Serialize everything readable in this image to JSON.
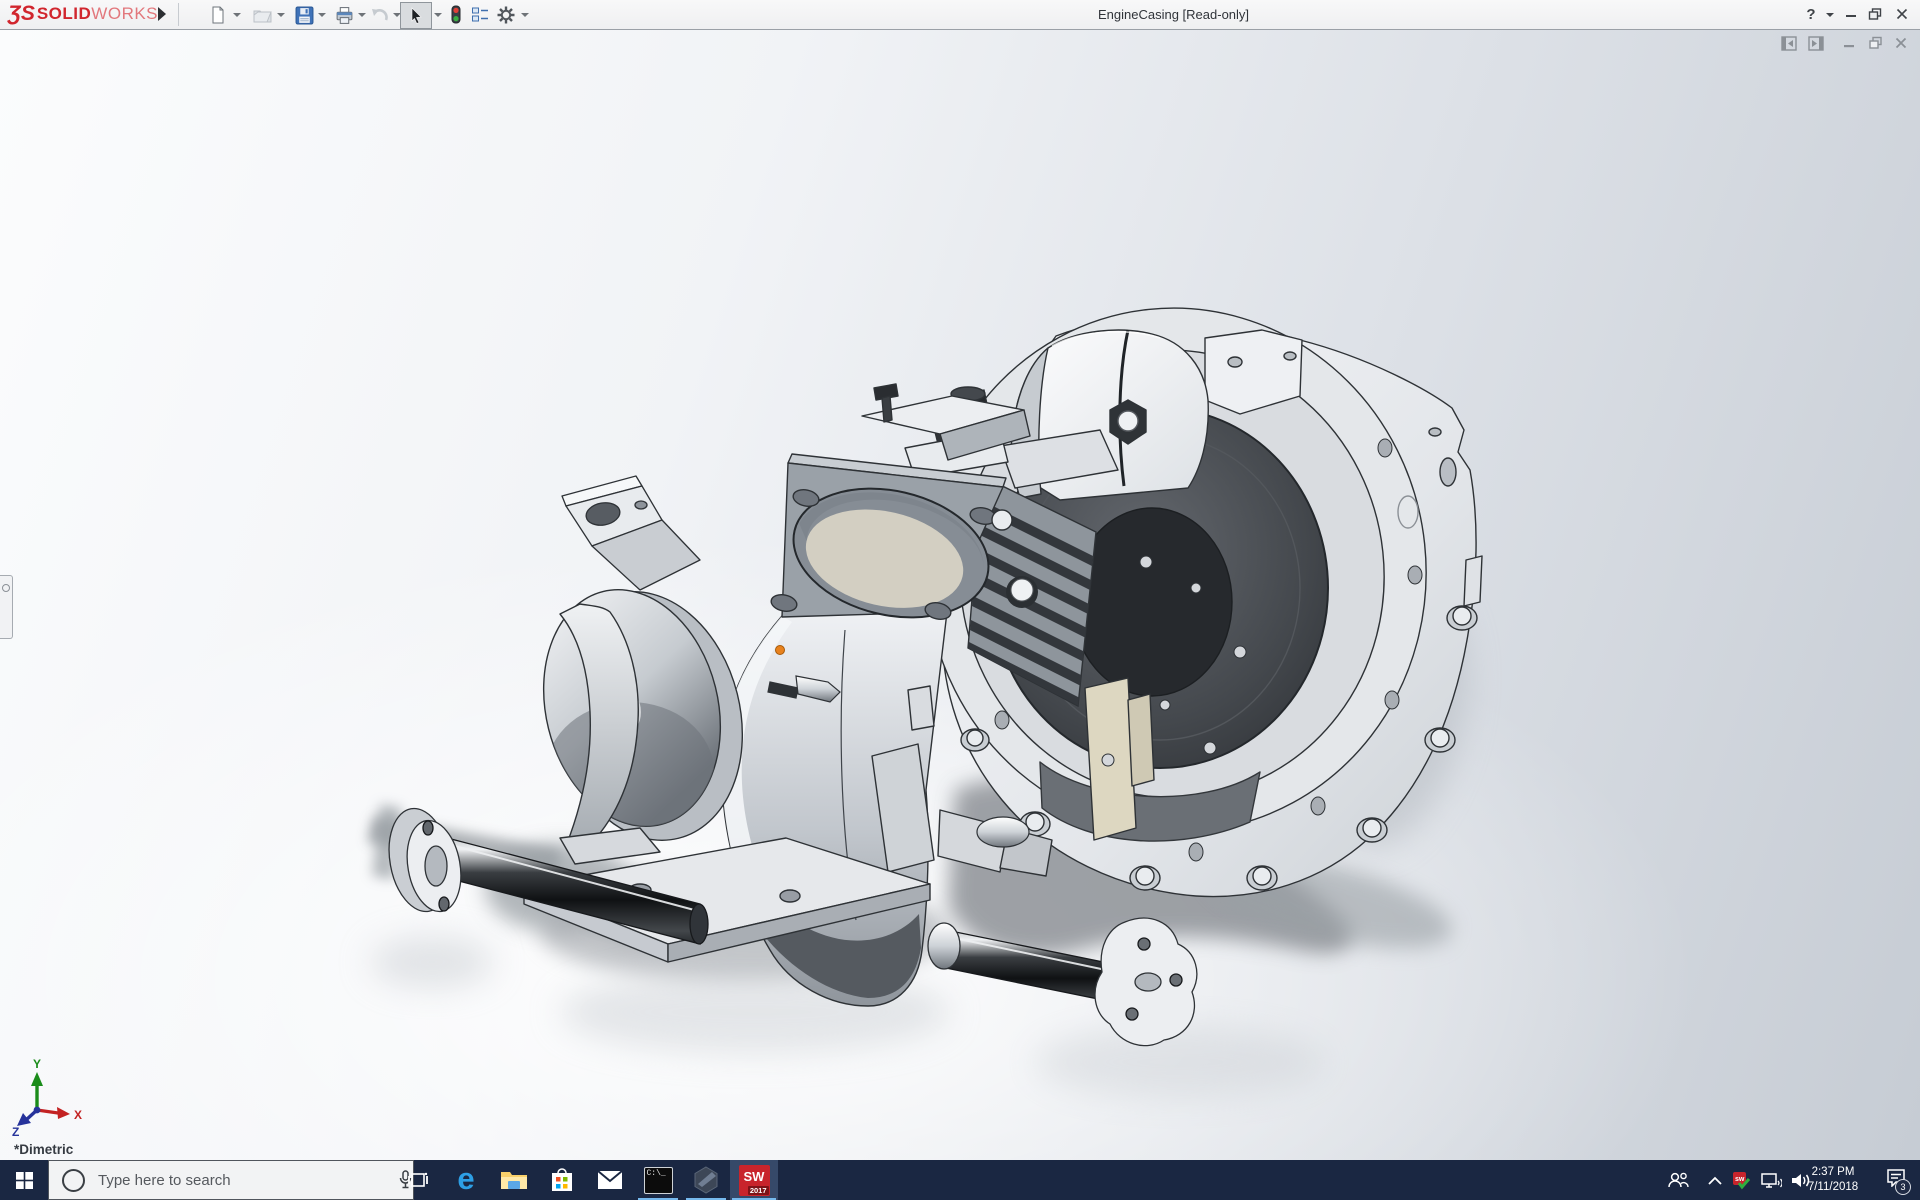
{
  "window": {
    "title": "EngineCasing [Read-only]"
  },
  "brand": {
    "glyph": "ƷS",
    "name_bold": "SOLID",
    "name_light": "WORKS"
  },
  "titlebar": {
    "help_label": "?",
    "icons": [
      "new-document",
      "open",
      "save",
      "print",
      "undo",
      "select-cursor",
      "rebuild-traffic-light",
      "display-pane",
      "settings-gear"
    ],
    "window_controls": [
      "help",
      "minimize",
      "restore",
      "close"
    ]
  },
  "document_window": {
    "controls": [
      "pane-left",
      "pane-right",
      "minimize",
      "restore",
      "close"
    ]
  },
  "viewport": {
    "orientation_label": "*Dimetric",
    "triad": {
      "x": "X",
      "y": "Y",
      "z": "Z"
    },
    "model": "engine-casing-assembly-on-stand",
    "selection_marker_color": "#e8821e",
    "collapsed_feature-tree_tab": true
  },
  "taskbar": {
    "search_placeholder": "Type here to search",
    "edge_glyph": "e",
    "cmd_label": "C:\\_",
    "sw_letters": "SW",
    "sw_badge_year": "2017",
    "apps": [
      "start",
      "search",
      "task-view",
      "edge",
      "file-explorer",
      "store",
      "mail",
      "command-prompt",
      "edrawings-hexagon",
      "solidworks-2017"
    ],
    "running_apps": [
      "command-prompt",
      "edrawings-hexagon",
      "solidworks-2017"
    ],
    "active_app": "solidworks-2017",
    "tray": {
      "icons": [
        "people",
        "hidden-icons-chevron",
        "solidworks-background-task",
        "network",
        "volume",
        "action-center"
      ],
      "time": "2:37 PM",
      "date": "7/11/2018",
      "notification_count": "3"
    }
  },
  "colors": {
    "taskbar_bg": "#1a2742",
    "running_underline": "#76b9ed",
    "brand_red": "#d1262e",
    "selection_orange": "#e8821e",
    "titlebar_bg": "#f2f3f4",
    "viewport_gradient_top_right": "#c6ccd4",
    "viewport_floor": "#ffffff"
  }
}
